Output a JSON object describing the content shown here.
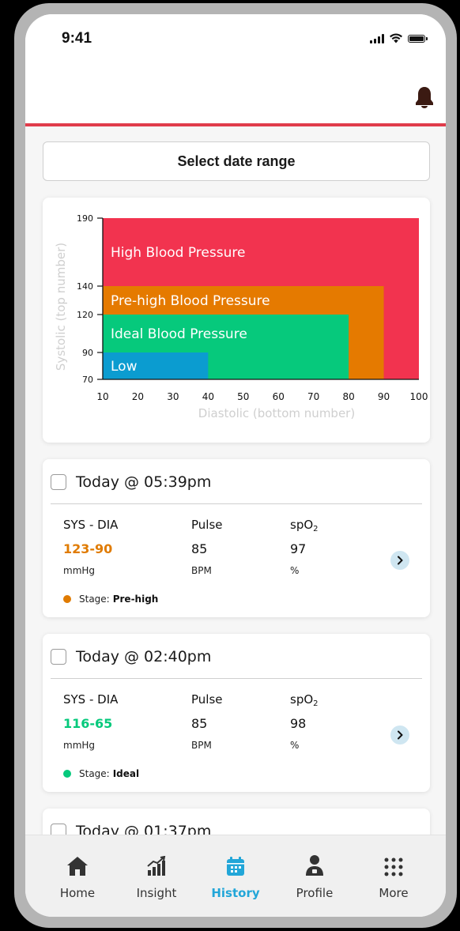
{
  "status_bar": {
    "time": "9:41"
  },
  "header": {
    "bell_icon": "bell-icon",
    "accent_color": "#e03c4b"
  },
  "date_range": {
    "label": "Select date range"
  },
  "chart_data": {
    "type": "area",
    "xlabel": "Diastolic (bottom number)",
    "ylabel": "Systolic (top number)",
    "xlim": [
      10,
      100
    ],
    "ylim": [
      70,
      190
    ],
    "x_ticks": [
      "10",
      "20",
      "30",
      "40",
      "50",
      "60",
      "70",
      "80",
      "90",
      "100"
    ],
    "y_ticks": [
      "190",
      "140",
      "120",
      "90",
      "70"
    ],
    "zones": [
      {
        "name": "High Blood Pressure",
        "x_max": 100,
        "y_max": 190,
        "color": "#f2334f"
      },
      {
        "name": "Pre-high Blood Pressure",
        "x_max": 90,
        "y_max": 140,
        "color": "#e57a00"
      },
      {
        "name": "Ideal Blood Pressure",
        "x_max": 80,
        "y_max": 120,
        "color": "#06c97c"
      },
      {
        "name": "Low",
        "x_max": 40,
        "y_max": 90,
        "color": "#0b9cd0"
      }
    ]
  },
  "readings": [
    {
      "title": "Today @ 05:39pm",
      "sys_dia_label": "SYS - DIA",
      "pulse_label": "Pulse",
      "spo2_label": "spO",
      "spo2_sub": "2",
      "bp_value": "123-90",
      "bp_color": "#e07b00",
      "pulse_value": "85",
      "spo2_value": "97",
      "bp_unit": "mmHg",
      "pulse_unit": "BPM",
      "spo2_unit": "%",
      "stage_prefix": "Stage:",
      "stage": "Pre-high",
      "stage_color": "#e07b00"
    },
    {
      "title": "Today @ 02:40pm",
      "sys_dia_label": "SYS - DIA",
      "pulse_label": "Pulse",
      "spo2_label": "spO",
      "spo2_sub": "2",
      "bp_value": "116-65",
      "bp_color": "#06c97c",
      "pulse_value": "85",
      "spo2_value": "98",
      "bp_unit": "mmHg",
      "pulse_unit": "BPM",
      "spo2_unit": "%",
      "stage_prefix": "Stage:",
      "stage": "Ideal",
      "stage_color": "#06c97c"
    },
    {
      "title": "Today @ 01:37pm"
    }
  ],
  "nav": {
    "items": [
      {
        "label": "Home",
        "icon": "home-icon"
      },
      {
        "label": "Insight",
        "icon": "insight-icon"
      },
      {
        "label": "History",
        "icon": "history-icon",
        "active": true
      },
      {
        "label": "Profile",
        "icon": "profile-icon"
      },
      {
        "label": "More",
        "icon": "more-icon"
      }
    ],
    "active_color": "#22a6d8"
  }
}
